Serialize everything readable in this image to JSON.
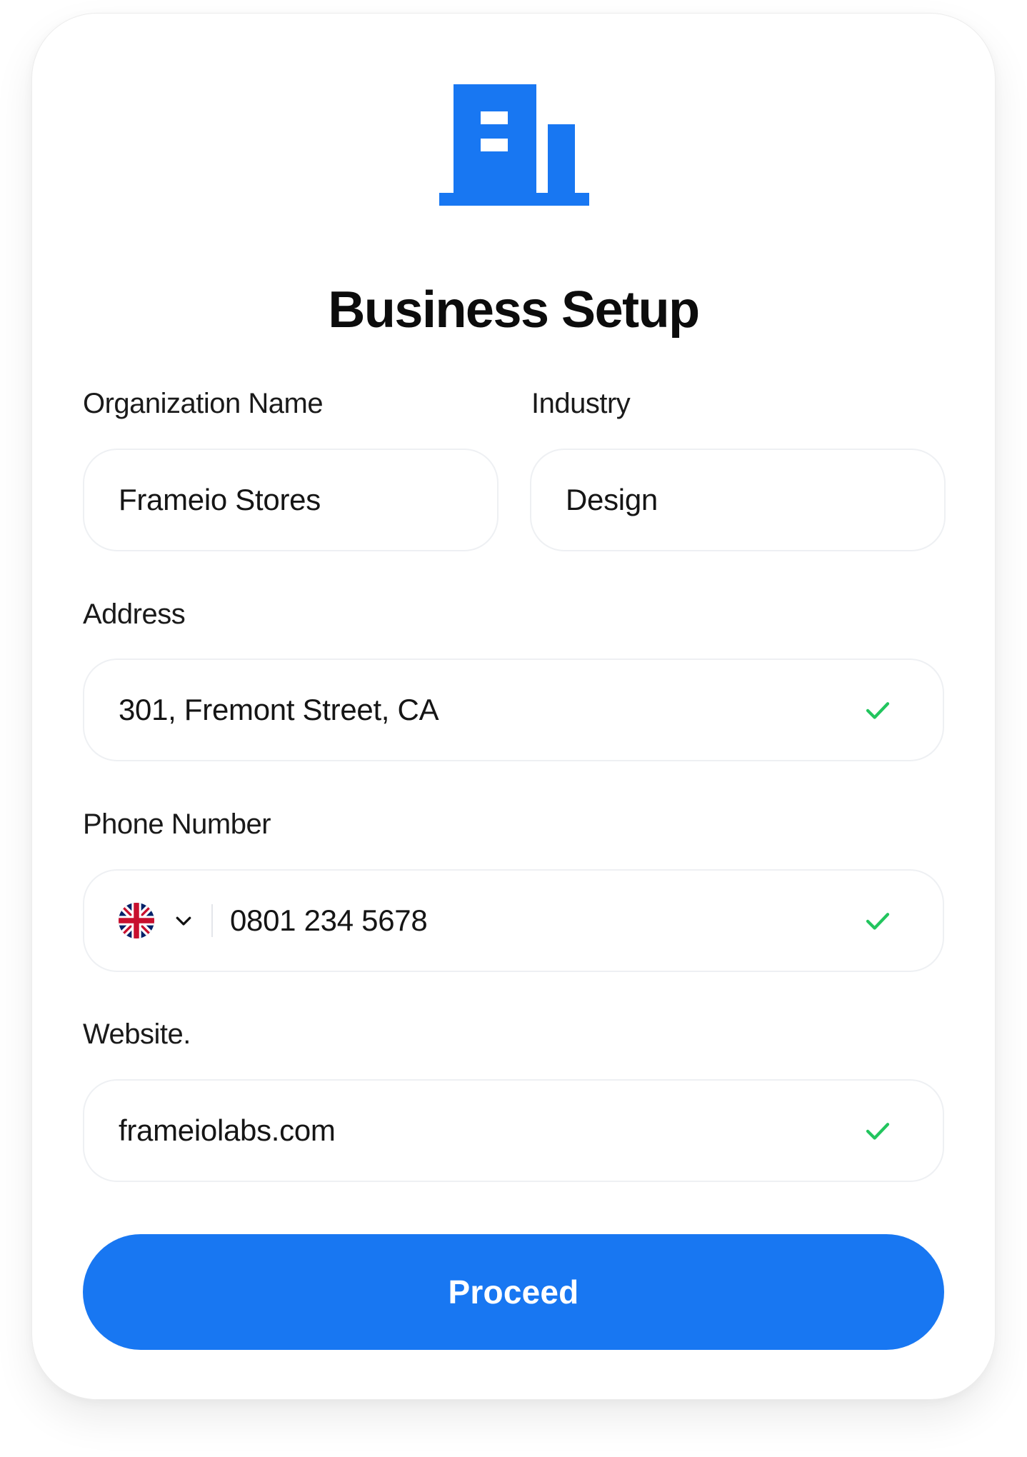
{
  "header": {
    "title": "Business Setup",
    "icon": "building-icon"
  },
  "form": {
    "organization": {
      "label": "Organization Name",
      "value": "Frameio Stores"
    },
    "industry": {
      "label": "Industry",
      "value": "Design"
    },
    "address": {
      "label": "Address",
      "value": "301, Fremont Street, CA",
      "validated": true
    },
    "phone": {
      "label": "Phone Number",
      "value": "0801 234 5678",
      "country_flag": "uk-flag-icon",
      "validated": true
    },
    "website": {
      "label": "Website.",
      "value": "frameiolabs.com",
      "validated": true
    }
  },
  "actions": {
    "proceed_label": "Proceed"
  },
  "colors": {
    "accent": "#1877f2",
    "success": "#22c55e",
    "field_border": "#eef0f3"
  }
}
